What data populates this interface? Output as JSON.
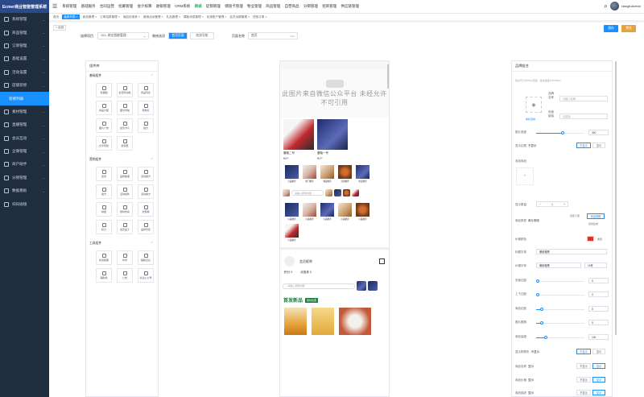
{
  "app": {
    "title": "Ecmer商业智能管理系统"
  },
  "sidebar": {
    "items": [
      {
        "label": "系统管理"
      },
      {
        "label": "商品管理"
      },
      {
        "label": "订单管理"
      },
      {
        "label": "基础设置"
      },
      {
        "label": "活动设置"
      },
      {
        "label": "店铺装修"
      },
      {
        "label": "装修列表",
        "active": true
      },
      {
        "label": "素材管理"
      },
      {
        "label": "直播管理"
      },
      {
        "label": "会员互动"
      },
      {
        "label": "企微管理"
      },
      {
        "label": "商户助手"
      },
      {
        "label": "分销管理"
      },
      {
        "label": "数据看板"
      },
      {
        "label": "扫码收银"
      }
    ]
  },
  "topbar": {
    "menus": [
      "系统管理",
      "基础服务",
      "合同运营",
      "招募管理",
      "会计核算",
      "收银管理",
      "CRM系统",
      "商城",
      "促销管理",
      "储值卡管理",
      "物业管理",
      "商品管理",
      "自营商品",
      "分销管理",
      "招商管理",
      "供应链管理"
    ],
    "active_index": 7,
    "username": "xiangfuAdmin"
  },
  "tags": [
    "首页",
    "装修列表 ×",
    "商品管理 ×",
    "订单结算管理 ×",
    "商品优惠券 ×",
    "营销活动管理 ×",
    "礼品管理 ×",
    "模板消息管理 ×",
    "优惠账户管理 ×",
    "会员余额管理 ×",
    "短信订单 ×"
  ],
  "back_label": "< 返回",
  "actions": {
    "save": "保存",
    "preview": "预览"
  },
  "form": {
    "project_label": "选择项目",
    "project_value": "101--商业智能管理",
    "template_label": "装修选项",
    "tab_home": "首页页面",
    "tab_nav": "底部导航",
    "page_name_label": "页面名称",
    "page_name_value": "首页",
    "page_name_count": "2/30"
  },
  "component_lib": {
    "title": "组件库",
    "groups": [
      {
        "name": "基础组件",
        "items": [
          "轮播图",
          "会员码功能",
          "商品列表",
          "商品分组",
          "图文导航",
          "导航栏",
          "图片广告",
          "会员卡片",
          "魔方",
          "文字导航",
          "搜索框"
        ]
      },
      {
        "name": "营销组件",
        "items": [
          "签到",
          "品牌故事",
          "活动魔方",
          "魔方",
          "活动组件",
          "活动魔方",
          "拼团",
          "限时秒杀",
          "优惠券",
          "积分",
          "会员盒子",
          "品牌专区"
        ]
      },
      {
        "name": "工具组件",
        "items": [
          "在线客服",
          "布局",
          "辅助空白",
          "辅助线",
          "公告",
          "关注公众号"
        ]
      }
    ]
  },
  "phone": {
    "banner_text": "此图片来自微信公众平台 未经允许不可引用",
    "products": [
      {
        "name": "唇釉二号",
        "price": "¥1**"
      },
      {
        "name": "唇釉一号",
        "price": "¥1**"
      }
    ],
    "grid1": [
      "小品推荐",
      "热门推荐",
      "奢品推荐",
      "活动推荐",
      "热卖推荐"
    ],
    "search_placeholder": "请输入搜索内容",
    "grid2": [
      "小品推荐",
      "小品推荐",
      "小品推荐",
      "小品推荐",
      "小品推荐",
      "小品推荐"
    ],
    "member_name": "会员昵称",
    "points_label": "积分",
    "points_value": "0",
    "coupon_label": "优惠券",
    "coupon_value": "0",
    "search2_placeholder": "请输入搜索内容",
    "section_title": "首发新品",
    "section_badge": "限时优惠"
  },
  "settings": {
    "title": "品牌组合",
    "tip": "建议尺寸为375x高度，建议宽度375*120px",
    "brand_name_label": "品牌名称",
    "brand_name_placeholder": "请输入品牌",
    "page_link_label": "页面链接",
    "page_link_placeholder": "请选择",
    "reupload": "重新选择",
    "image_width_label": "图片宽度",
    "image_width_value": "320",
    "image_width_fraction": 0.55,
    "show_border_label": "显示边框",
    "show_border_value": "不显示",
    "opt_hide": "不显示",
    "opt_show": "显示",
    "add_product_label": "添加商品",
    "display_count_label": "显示数量",
    "display_count_value": "1",
    "product_type_label": "商品类型",
    "product_type_value": "单片规则",
    "opt_self": "自定义值",
    "opt_goods": "商品规格",
    "opt_auto": "自动生成",
    "price_color_label": "价格颜色",
    "price_color": "#d9322b",
    "price_color_reset": "重置",
    "title_font_label": "标题字体",
    "title_font_value": "微软雅黑",
    "price_font_label": "价格字体",
    "price_font_value": "微软雅黑",
    "price_size_value": "16号",
    "page_margin_label": "页面边距",
    "page_margin_value": "0",
    "padding_label": "上下边距",
    "padding_value": "0",
    "goods_margin_label": "商品边距",
    "goods_margin_value": "5",
    "goods_margin_fraction": 0.12,
    "image_radius_label": "图片圆角",
    "image_radius_value": "5",
    "image_radius_fraction": 0.12,
    "goods_height_label": "商品高度",
    "goods_height_value": "100",
    "goods_height_fraction": 0.2,
    "show_shopping_label": "显示购物车",
    "show_shopping_value": "不显示",
    "goods_name_label": "商品名称",
    "goods_name_value": "显示",
    "goods_price_label": "商品价格",
    "goods_price_value": "显示",
    "goods_desc_label": "商品描述",
    "goods_desc_value": "显示"
  }
}
